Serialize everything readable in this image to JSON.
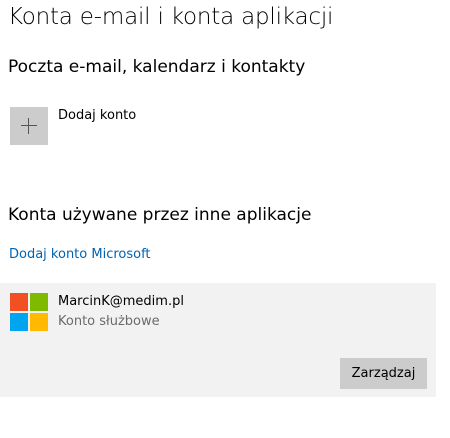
{
  "page": {
    "title": "Konta e-mail i konta aplikacji"
  },
  "mail_section": {
    "heading": "Poczta e-mail, kalendarz i kontakty",
    "add_account_label": "Dodaj konto",
    "add_account_icon": "plus-icon"
  },
  "other_apps_section": {
    "heading": "Konta używane przez inne aplikacje",
    "add_microsoft_link": "Dodaj konto Microsoft",
    "link_color": "#0063b1",
    "account": {
      "logo_icon": "microsoft-logo-icon",
      "logo_colors": [
        "#f25022",
        "#7fba00",
        "#00a4ef",
        "#ffb900"
      ],
      "email": "MarcinK@medim.pl",
      "type": "Konto służbowe",
      "manage_button": "Zarządzaj"
    }
  }
}
